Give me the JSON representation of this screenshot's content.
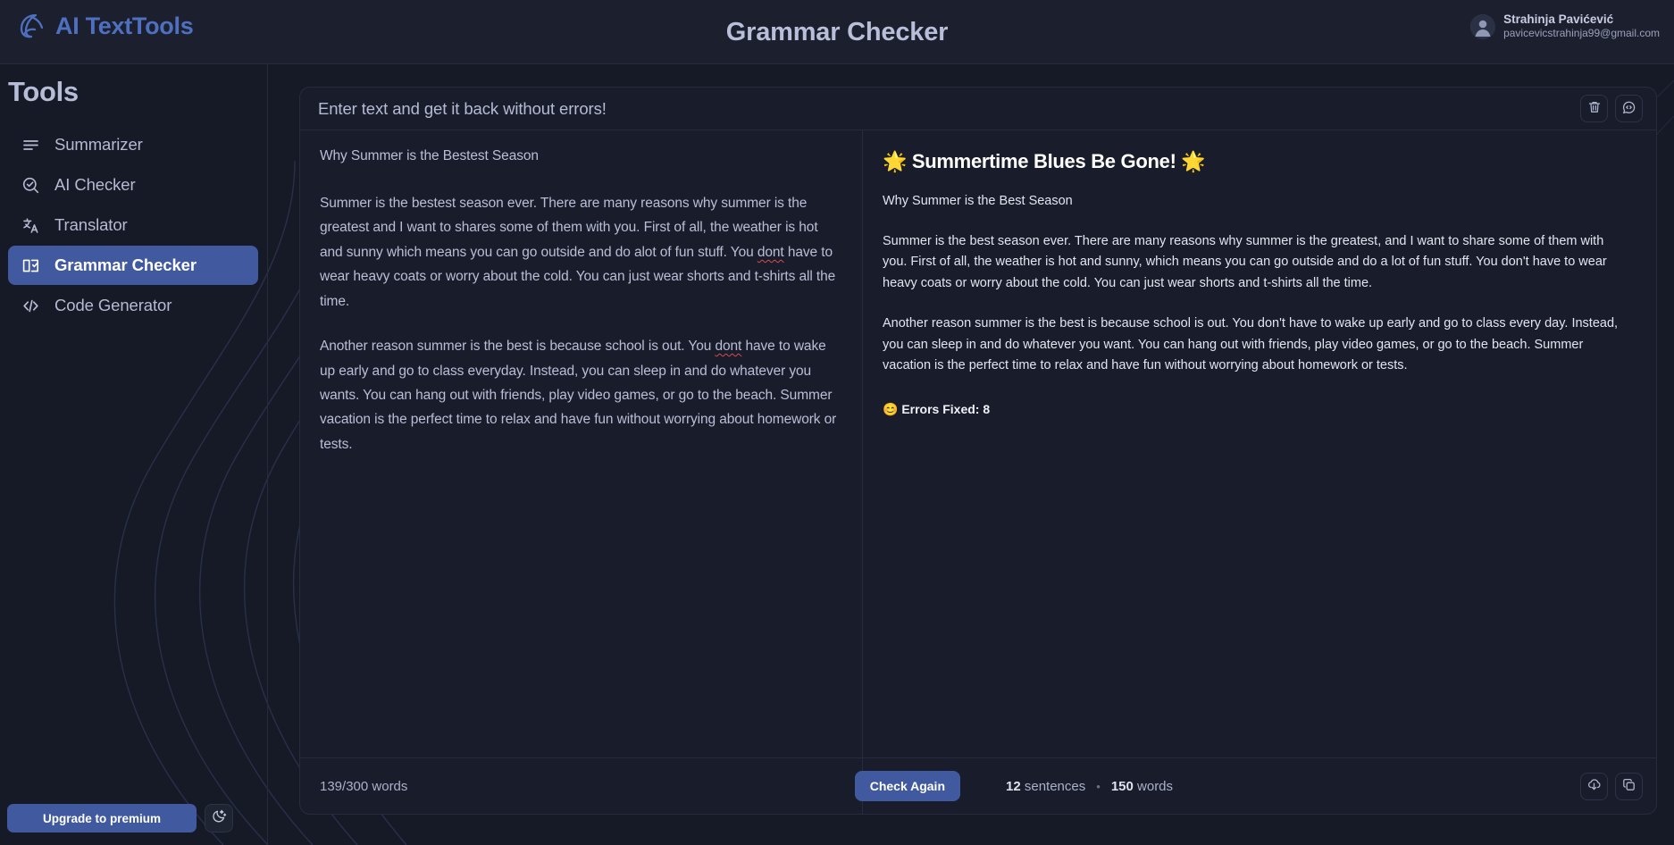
{
  "brand": {
    "name": "AI TextTools",
    "logo_icon": "feather-swoosh-icon"
  },
  "header": {
    "title": "Grammar Checker",
    "user": {
      "name": "Strahinja Pavićević",
      "email": "pavicevicstrahinja99@gmail.com",
      "avatar_icon": "user-avatar"
    }
  },
  "sidebar": {
    "title": "Tools",
    "items": [
      {
        "label": "Summarizer",
        "icon": "list-lines-icon",
        "active": false
      },
      {
        "label": "AI Checker",
        "icon": "magnifier-check-icon",
        "active": false
      },
      {
        "label": "Translator",
        "icon": "translate-icon",
        "active": false
      },
      {
        "label": "Grammar Checker",
        "icon": "open-book-check-icon",
        "active": true
      },
      {
        "label": "Code Generator",
        "icon": "code-brackets-icon",
        "active": false
      }
    ],
    "upgrade_label": "Upgrade to premium",
    "theme_toggle_icon": "moon-stars-icon"
  },
  "card": {
    "head_title": "Enter text and get it back without errors!",
    "actions": [
      {
        "name": "clear-button",
        "icon": "trash-icon"
      },
      {
        "name": "feedback-button",
        "icon": "chat-code-icon"
      }
    ]
  },
  "input_pane": {
    "title": "Why Summer is the Bestest Season",
    "paragraph_1_a": "Summer is the bestest season ever. There are many reasons why summer is the greatest and I want to shares some of them with you. First of all, the weather is hot and sunny which means you can go outside and do alot of fun stuff. You ",
    "paragraph_1_error": "dont",
    "paragraph_1_b": " have to wear heavy coats or worry about the cold. You can just wear shorts and t-shirts all the time.",
    "paragraph_2_a": "Another reason summer is the best is because school is out. You ",
    "paragraph_2_error": "dont",
    "paragraph_2_b": " have to wake up early and go to class everyday. Instead, you can sleep in and do whatever you wants. You can hang out with friends, play video games, or go to the beach. Summer vacation is the perfect time to relax and have fun without worrying about homework or tests."
  },
  "output_pane": {
    "heading": "🌟 Summertime Blues Be Gone! 🌟",
    "title": "Why Summer is the Best Season",
    "paragraph_1": "Summer is the best season ever. There are many reasons why summer is the greatest, and I want to share some of them with you. First of all, the weather is hot and sunny, which means you can go outside and do a lot of fun stuff. You don't have to wear heavy coats or worry about the cold. You can just wear shorts and t-shirts all the time.",
    "paragraph_2": "Another reason summer is the best is because school is out. You don't have to wake up early and go to class every day. Instead, you can sleep in and do whatever you want. You can hang out with friends, play video games, or go to the beach. Summer vacation is the perfect time to relax and have fun without worrying about homework or tests.",
    "errors_fixed": "😊 Errors Fixed: 8"
  },
  "footer": {
    "word_count": "139/300 words",
    "check_again_label": "Check Again",
    "sentence_number": "12",
    "sentence_label": "sentences",
    "separator": "•",
    "word_number": "150",
    "word_label": "words",
    "actions": [
      {
        "name": "download-button",
        "icon": "cloud-download-icon"
      },
      {
        "name": "copy-button",
        "icon": "copy-icon"
      }
    ]
  },
  "colors": {
    "accent": "#41599f",
    "brand": "#4f6fbf",
    "page_bg": "#161a27",
    "card_bg": "#191d2b",
    "error_underline": "#d64b4b"
  }
}
